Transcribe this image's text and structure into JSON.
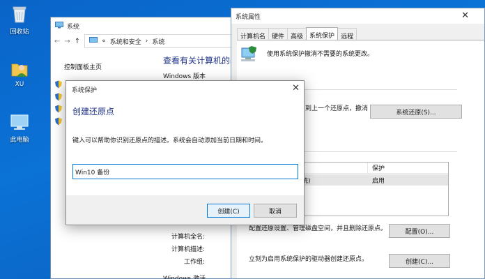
{
  "desktop": {
    "icons": [
      {
        "label": "回收站",
        "icon": "recycle-bin-icon"
      },
      {
        "label": "XU",
        "icon": "user-folder-icon"
      },
      {
        "label": "此电脑",
        "icon": "this-pc-icon"
      }
    ]
  },
  "system_window": {
    "title": "系统",
    "breadcrumb": {
      "sep_prefix": "«",
      "items": [
        "系统和安全",
        "系统"
      ]
    },
    "control_panel_home": "控制面板主页",
    "heading": "查看有关计算机的基",
    "windows_edition_label": "Windows 版本",
    "info_labels": [
      "计算机全名:",
      "计算机描述:",
      "工作组:"
    ],
    "activation_label": "Windows 激活"
  },
  "properties_window": {
    "title": "系统属性",
    "tabs": [
      "计算机名",
      "硬件",
      "高级",
      "系统保护",
      "远程"
    ],
    "active_tab": "系统保护",
    "intro_text": "使用系统保护撤消不需要的系统更改。",
    "restore_text": "到上一个还原点，撤消",
    "restore_button": "系统还原(S)...",
    "grid": {
      "header_protect": "保护",
      "rows": [
        {
          "drive": "统)",
          "status": "启用"
        }
      ]
    },
    "configure_text": "配置还原设置、管理磁盘空间，并且删除还原点。",
    "configure_button": "配置(O)...",
    "create_text": "立刻为启用系统保护的驱动器创建还原点。",
    "create_button": "创建(C)..."
  },
  "dialog": {
    "title": "系统保护",
    "heading": "创建还原点",
    "description": "键入可以帮助你识别还原点的描述。系统会自动添加当前日期和时间。",
    "input_value": "Win10 备份",
    "create_button": "创建(C)",
    "cancel_button": "取消"
  },
  "colors": {
    "desktop_bg": "#0b6ccf",
    "accent": "#0078d7",
    "heading_blue": "#1e3287"
  }
}
